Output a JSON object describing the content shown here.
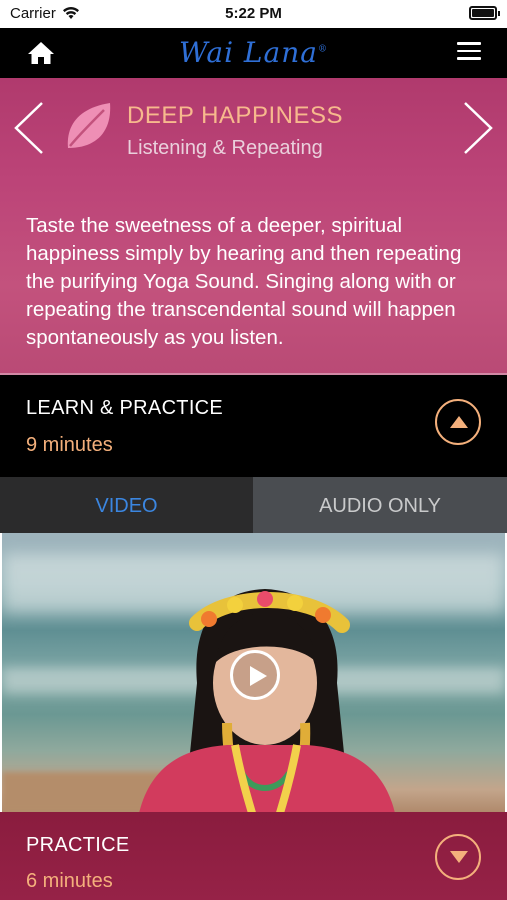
{
  "status_bar": {
    "carrier": "Carrier",
    "time": "5:22 PM",
    "wifi_icon": "wifi-icon",
    "battery_icon": "battery-icon"
  },
  "nav": {
    "home_icon": "home-icon",
    "logo_text": "Wai Lana",
    "logo_mark": "®",
    "menu_icon": "hamburger-menu-icon",
    "logo_color": "#2f6fd6"
  },
  "hero": {
    "title": "DEEP HAPPINESS",
    "subtitle": "Listening & Repeating",
    "description": "Taste the sweetness of a deeper, spiritual happiness simply by hearing and then repeating the purifying Yoga Sound. Singing along with or repeating the transcendental sound will happen spontaneously as you listen.",
    "icon": "leaf-icon",
    "prev_icon": "chevron-left-icon",
    "next_icon": "chevron-right-icon",
    "title_color": "#f7b98d",
    "background_color": "#bc4478"
  },
  "learn_section": {
    "label": "LEARN & PRACTICE",
    "duration": "9 minutes",
    "toggle_icon": "collapse-up-icon"
  },
  "media_tabs": {
    "video_label": "VIDEO",
    "audio_label": "AUDIO ONLY",
    "active": "VIDEO",
    "active_color": "#3b86e0"
  },
  "video": {
    "play_icon": "play-icon"
  },
  "practice_section": {
    "label": "PRACTICE",
    "duration": "6 minutes",
    "toggle_icon": "expand-down-icon",
    "background_color": "#8a1c3e"
  },
  "accent_color": "#f4b07c"
}
